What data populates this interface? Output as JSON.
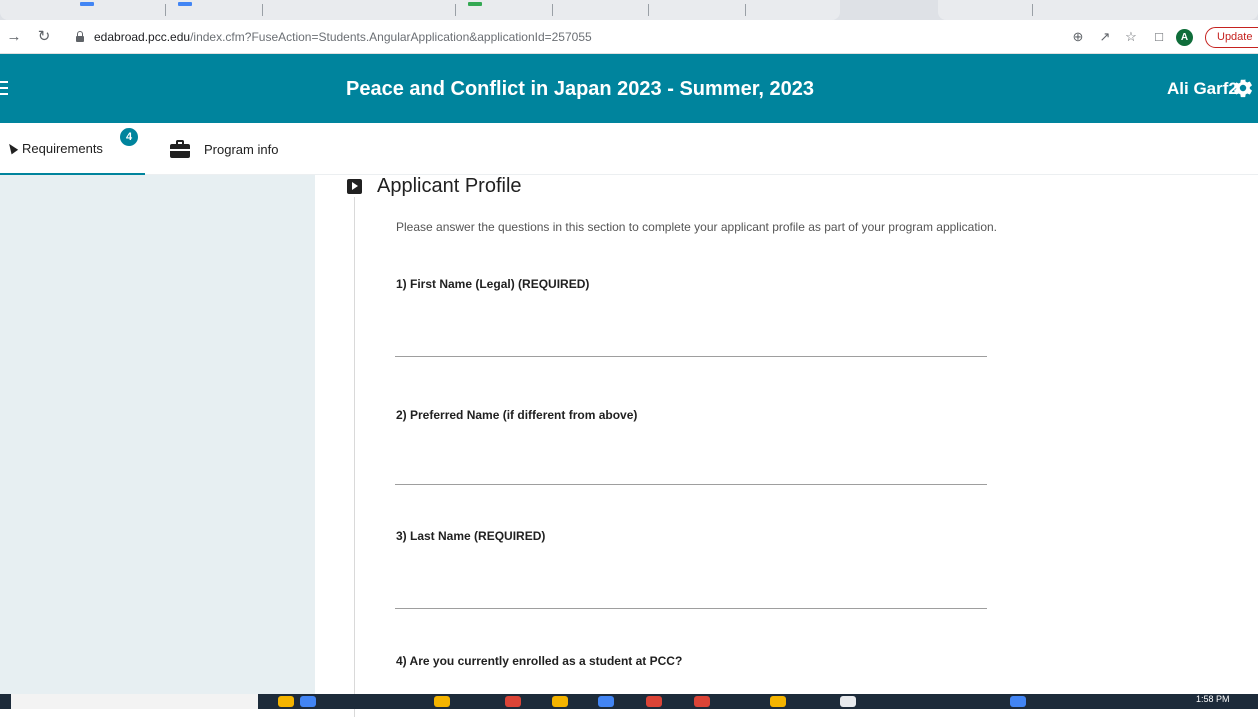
{
  "browser": {
    "url_host": "edabroad.pcc.edu",
    "url_path": "/index.cfm?FuseAction=Students.AngularApplication&applicationId=257055",
    "profile_initial": "A",
    "update_label": "Update"
  },
  "header": {
    "title": "Peace and Conflict in Japan 2023 - Summer, 2023",
    "user_name": "Ali Garf2"
  },
  "tabs": [
    {
      "label": "Requirements",
      "badge": "4",
      "active": true
    },
    {
      "label": "Program info",
      "active": false
    }
  ],
  "section": {
    "title": "Applicant Profile",
    "intro": "Please answer the questions in this section to complete your applicant profile as part of your program application."
  },
  "questions": [
    {
      "label": "1) First Name (Legal)  (REQUIRED)",
      "value": ""
    },
    {
      "label": "2) Preferred Name (if different from above)",
      "value": ""
    },
    {
      "label": "3) Last Name  (REQUIRED)",
      "value": ""
    },
    {
      "label": "4) Are you currently enrolled as a student at PCC?"
    }
  ],
  "taskbar": {
    "clock": "1:58 PM"
  },
  "colors": {
    "brand": "#00849d",
    "sidebar": "#e7eff2"
  }
}
